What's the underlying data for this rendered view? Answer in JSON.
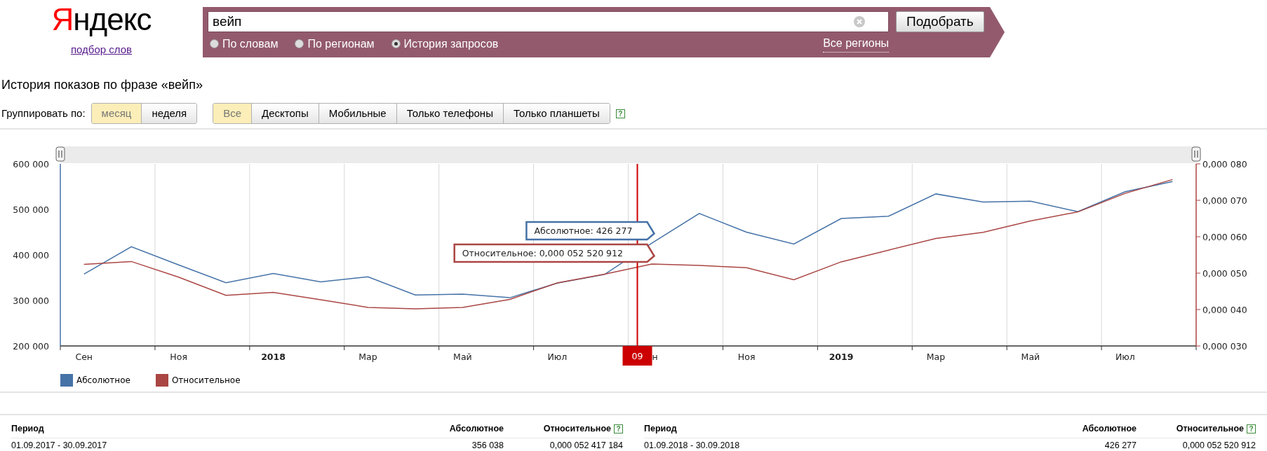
{
  "logo": "Яндекс",
  "subtitle_link": "подбор слов",
  "search": {
    "value": "вейп",
    "button": "Подобрать",
    "region_link": "Все регионы",
    "modes": [
      {
        "label": "По словам",
        "selected": false
      },
      {
        "label": "По регионам",
        "selected": false
      },
      {
        "label": "История запросов",
        "selected": true
      }
    ]
  },
  "heading": "История показов по фразе «вейп»",
  "group_by": {
    "label": "Группировать по:",
    "options": [
      {
        "label": "месяц",
        "selected": true
      },
      {
        "label": "неделя",
        "selected": false
      }
    ]
  },
  "devices": [
    {
      "label": "Все",
      "selected": true
    },
    {
      "label": "Десктопы",
      "selected": false
    },
    {
      "label": "Мобильные",
      "selected": false
    },
    {
      "label": "Только телефоны",
      "selected": false
    },
    {
      "label": "Только планшеты",
      "selected": false
    }
  ],
  "help": "?",
  "chart_data": {
    "type": "line",
    "categories": [
      "Сен",
      null,
      "Ноя",
      null,
      "2018",
      null,
      "Мар",
      null,
      "Май",
      null,
      "Июл",
      null,
      "н",
      null,
      "Ноя",
      null,
      "2019",
      null,
      "Мар",
      null,
      "Май",
      null,
      "Июл",
      null
    ],
    "ylim": [
      200000,
      600000
    ],
    "yticks": [
      {
        "value": 200000,
        "label": "200 000"
      },
      {
        "value": 300000,
        "label": "300 000"
      },
      {
        "value": 400000,
        "label": "400 000"
      },
      {
        "value": 500000,
        "label": "500 000"
      },
      {
        "value": 600000,
        "label": "600 000"
      }
    ],
    "y2lim": [
      3e-05,
      8e-05
    ],
    "y2ticks": [
      {
        "value": 3e-05,
        "label": "0,000 030"
      },
      {
        "value": 4e-05,
        "label": "0,000 040"
      },
      {
        "value": 5e-05,
        "label": "0,000 050"
      },
      {
        "value": 6e-05,
        "label": "0,000 060"
      },
      {
        "value": 7e-05,
        "label": "0,000 070"
      },
      {
        "value": 8e-05,
        "label": "0,000 080"
      }
    ],
    "series": [
      {
        "name": "Абсолютное",
        "color": "#4572a7",
        "values": [
          358000,
          418000,
          378000,
          339000,
          359000,
          341000,
          352000,
          312000,
          314000,
          306000,
          338000,
          357000,
          426000,
          491000,
          450000,
          424000,
          480000,
          485000,
          534000,
          516000,
          518000,
          495000,
          539000,
          561000
        ]
      },
      {
        "name": "Относительное",
        "color": "#aa4643",
        "axis": "y2",
        "values": [
          5.24e-05,
          5.32e-05,
          4.89e-05,
          4.39e-05,
          4.47e-05,
          4.27e-05,
          4.06e-05,
          4.02e-05,
          4.06e-05,
          4.28e-05,
          4.73e-05,
          4.97e-05,
          5.25e-05,
          5.21e-05,
          5.15e-05,
          4.82e-05,
          5.31e-05,
          5.63e-05,
          5.95e-05,
          6.12e-05,
          6.43e-05,
          6.68e-05,
          7.19e-05,
          7.57e-05
        ]
      }
    ],
    "grid": true,
    "legend": "bottom",
    "annotations": [
      "09",
      "Абсолютное: 426 277",
      "Относительное: 0,000 052 520 912"
    ]
  },
  "table": {
    "halves": [
      {
        "columns": [
          "Период",
          "Абсолютное",
          "Относительное"
        ],
        "rows": [
          [
            "01.09.2017 - 30.09.2017",
            "356 038",
            "0,000 052 417 184"
          ]
        ]
      },
      {
        "columns": [
          "Период",
          "Абсолютное",
          "Относительное"
        ],
        "rows": [
          [
            "01.09.2018 - 30.09.2018",
            "426 277",
            "0,000 052 520 912"
          ]
        ]
      }
    ]
  }
}
